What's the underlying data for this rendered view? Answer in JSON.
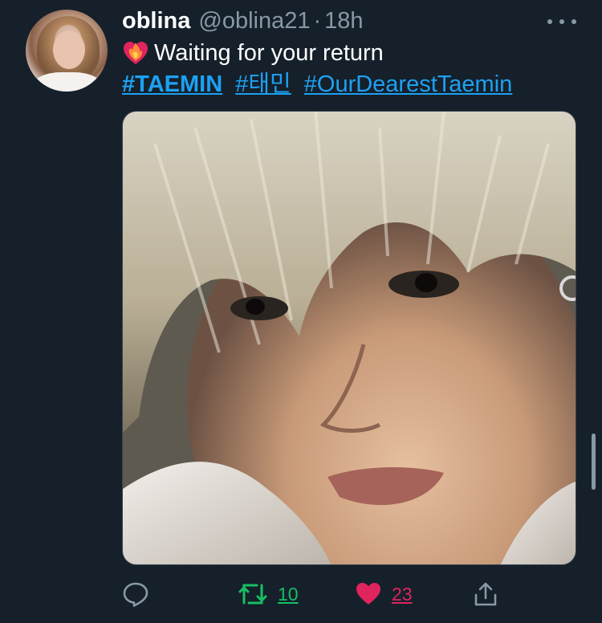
{
  "tweet": {
    "author_name": "oblina",
    "author_handle": "@oblina21",
    "separator": "·",
    "timestamp": "18h",
    "text": "Waiting for your return",
    "emoji": "heart-on-fire",
    "hashtags": [
      "#TAEMIN",
      "#태민",
      "#OurDearestTaemin"
    ]
  },
  "actions": {
    "reply_icon": "reply-bubble-icon",
    "retweet_icon": "retweet-icon",
    "retweet_count": "10",
    "like_icon": "heart-icon",
    "like_count": "23",
    "share_icon": "share-upload-icon"
  },
  "colors": {
    "background": "#15202b",
    "link": "#1da1f2",
    "muted": "#8899a6",
    "retweet": "#17bf63",
    "like": "#e0245e"
  }
}
